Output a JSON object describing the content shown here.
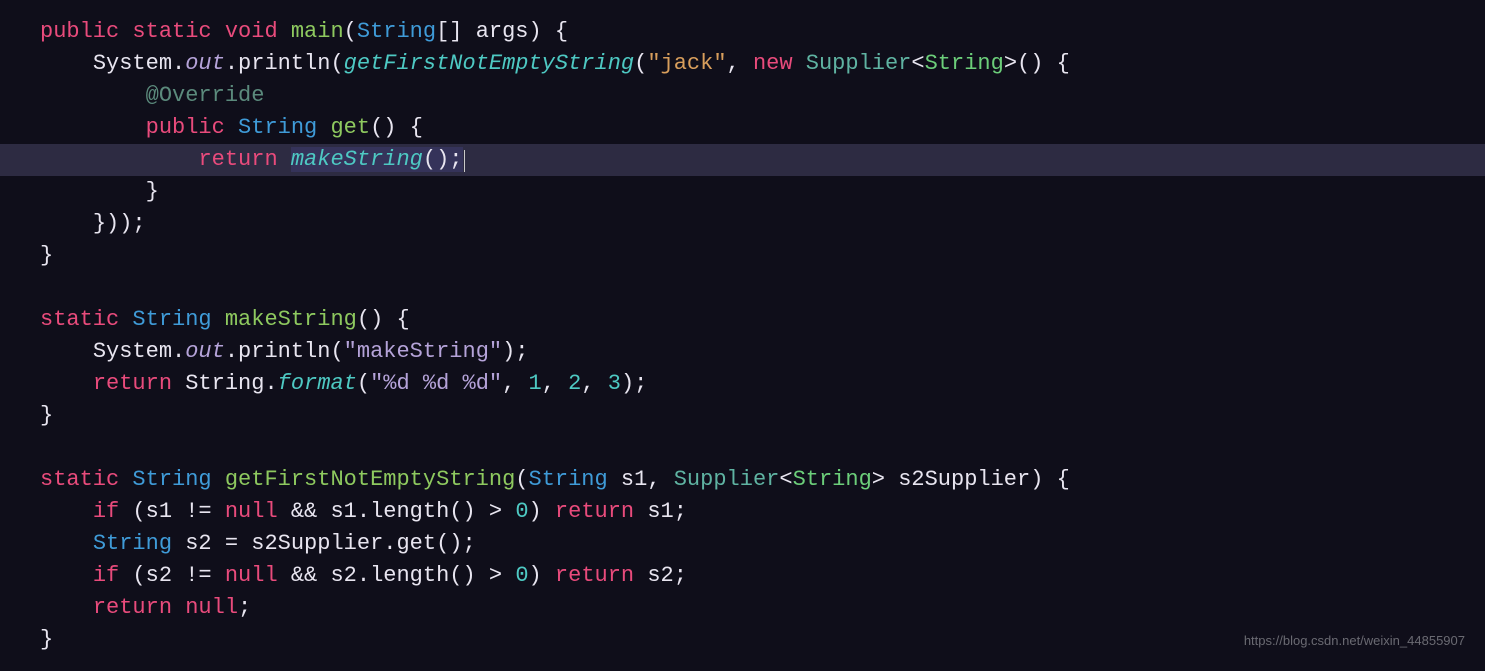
{
  "code": {
    "line1": {
      "kw_public": "public",
      "kw_static": "static",
      "kw_void": "void",
      "method": "main",
      "paren_open": "(",
      "type": "String",
      "brackets": "[]",
      "sp": " ",
      "param": "args",
      "paren_close": ")",
      "sp2": " ",
      "brace": "{"
    },
    "line2": {
      "indent": "    ",
      "sys": "System",
      "dot1": ".",
      "out": "out",
      "dot2": ".",
      "println": "println",
      "po": "(",
      "call": "getFirstNotEmptyString",
      "po2": "(",
      "str": "\"jack\"",
      "comma": ", ",
      "new": "new",
      "sp": " ",
      "supplier": "Supplier",
      "lt": "<",
      "string": "String",
      "gt": ">",
      "po3": "()",
      "sp2": " ",
      "brace": "{"
    },
    "line3": {
      "indent": "        ",
      "anno": "@Override"
    },
    "line4": {
      "indent": "        ",
      "public": "public",
      "sp": " ",
      "type": "String",
      "sp2": " ",
      "method": "get",
      "parens": "()",
      "sp3": " ",
      "brace": "{"
    },
    "line5": {
      "indent": "            ",
      "return": "return",
      "sp": " ",
      "call": "makeString",
      "parens": "()",
      "semi": ";"
    },
    "line6": {
      "indent": "        ",
      "brace": "}"
    },
    "line7": {
      "indent": "    ",
      "close": "}));"
    },
    "line8": {
      "brace": "}"
    },
    "line9": {
      "blank": ""
    },
    "line10": {
      "static": "static",
      "sp": " ",
      "type": "String",
      "sp2": " ",
      "method": "makeString",
      "parens": "()",
      "sp3": " ",
      "brace": "{"
    },
    "line11": {
      "indent": "    ",
      "sys": "System",
      "dot1": ".",
      "out": "out",
      "dot2": ".",
      "println": "println",
      "po": "(",
      "str": "\"makeString\"",
      "pc": ");"
    },
    "line12": {
      "indent": "    ",
      "return": "return",
      "sp": " ",
      "type": "String",
      "dot": ".",
      "format": "format",
      "po": "(",
      "str": "\"%d %d %d\"",
      "c1": ", ",
      "n1": "1",
      "c2": ", ",
      "n2": "2",
      "c3": ", ",
      "n3": "3",
      "pc": ");"
    },
    "line13": {
      "brace": "}"
    },
    "line14": {
      "blank": ""
    },
    "line15": {
      "static": "static",
      "sp": " ",
      "type": "String",
      "sp2": " ",
      "method": "getFirstNotEmptyString",
      "po": "(",
      "ptype1": "String",
      "sp3": " ",
      "p1": "s1",
      "c": ", ",
      "supplier": "Supplier",
      "lt": "<",
      "string": "String",
      "gt": ">",
      "sp4": " ",
      "p2": "s2Supplier",
      "pc": ")",
      "sp5": " ",
      "brace": "{"
    },
    "line16": {
      "indent": "    ",
      "if": "if",
      "sp": " ",
      "po": "(",
      "s1": "s1",
      "sp2": " ",
      "ne": "!=",
      "sp3": " ",
      "null": "null",
      "sp4": " ",
      "and": "&&",
      "sp5": " ",
      "s1b": "s1",
      "dot": ".",
      "len": "length",
      "parens": "()",
      "sp6": " ",
      "gt": ">",
      "sp7": " ",
      "zero": "0",
      "pc": ")",
      "sp8": " ",
      "return": "return",
      "sp9": " ",
      "s1c": "s1",
      "semi": ";"
    },
    "line17": {
      "indent": "    ",
      "type": "String",
      "sp": " ",
      "s2": "s2",
      "sp2": " ",
      "eq": "=",
      "sp3": " ",
      "sup": "s2Supplier",
      "dot": ".",
      "get": "get",
      "parens": "()",
      "semi": ";"
    },
    "line18": {
      "indent": "    ",
      "if": "if",
      "sp": " ",
      "po": "(",
      "s2": "s2",
      "sp2": " ",
      "ne": "!=",
      "sp3": " ",
      "null": "null",
      "sp4": " ",
      "and": "&&",
      "sp5": " ",
      "s2b": "s2",
      "dot": ".",
      "len": "length",
      "parens": "()",
      "sp6": " ",
      "gt": ">",
      "sp7": " ",
      "zero": "0",
      "pc": ")",
      "sp8": " ",
      "return": "return",
      "sp9": " ",
      "s2c": "s2",
      "semi": ";"
    },
    "line19": {
      "indent": "    ",
      "return": "return",
      "sp": " ",
      "null": "null",
      "semi": ";"
    },
    "line20": {
      "brace": "}"
    }
  },
  "watermark": "https://blog.csdn.net/weixin_44855907"
}
